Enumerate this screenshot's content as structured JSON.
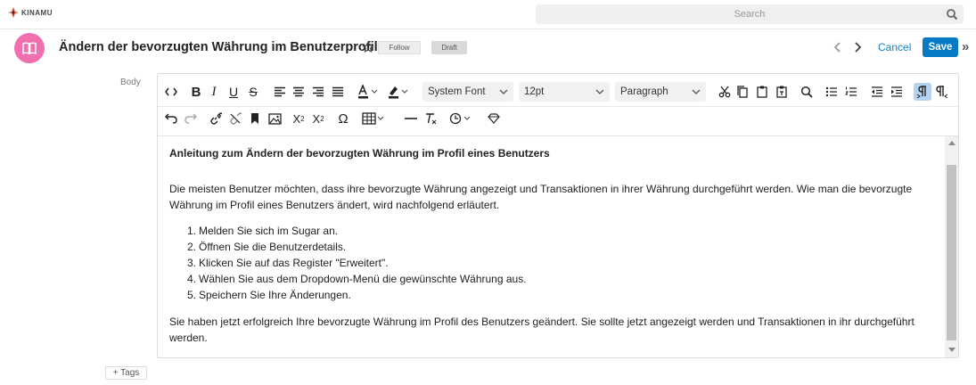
{
  "app": {
    "logo_text": "KINAMU",
    "search_placeholder": "Search"
  },
  "header": {
    "title": "Ändern der bevorzugten Währung im Benutzerprofil",
    "follow_label": "Follow",
    "status_badge": "Draft",
    "cancel_label": "Cancel",
    "save_label": "Save",
    "more_label": "»",
    "avatar_color": "#f06fae",
    "save_color": "#0679c7"
  },
  "field": {
    "label": "Body"
  },
  "toolbar": {
    "font_family": "System Font",
    "font_size": "12pt",
    "block_format": "Paragraph"
  },
  "document": {
    "heading": "Anleitung zum Ändern der bevorzugten Währung im Profil eines Benutzers",
    "intro": "Die meisten Benutzer möchten, dass ihre bevorzugte Währung angezeigt und Transaktionen in ihrer Währung durchgeführt werden. Wie man die bevorzugte Währung im Profil eines Benutzers ändert, wird nachfolgend erläutert.",
    "steps": [
      {
        "num": "1.",
        "text": "Melden Sie sich im Sugar an."
      },
      {
        "num": "2.",
        "text": "Öffnen Sie die Benutzerdetails."
      },
      {
        "num": "3.",
        "text": "Klicken Sie auf das Register \"Erweitert\"."
      },
      {
        "num": "4.",
        "text": "Wählen Sie aus dem Dropdown-Menü die gewünschte Währung aus."
      },
      {
        "num": "5.",
        "text": "Speichern Sie Ihre Änderungen."
      }
    ],
    "conclusion": "Sie haben jetzt erfolgreich Ihre bevorzugte Währung im Profil des Benutzers geändert. Sie sollte jetzt angezeigt werden und Transaktionen in ihr durchgeführt werden."
  },
  "footer": {
    "tags_label": "+ Tags"
  }
}
